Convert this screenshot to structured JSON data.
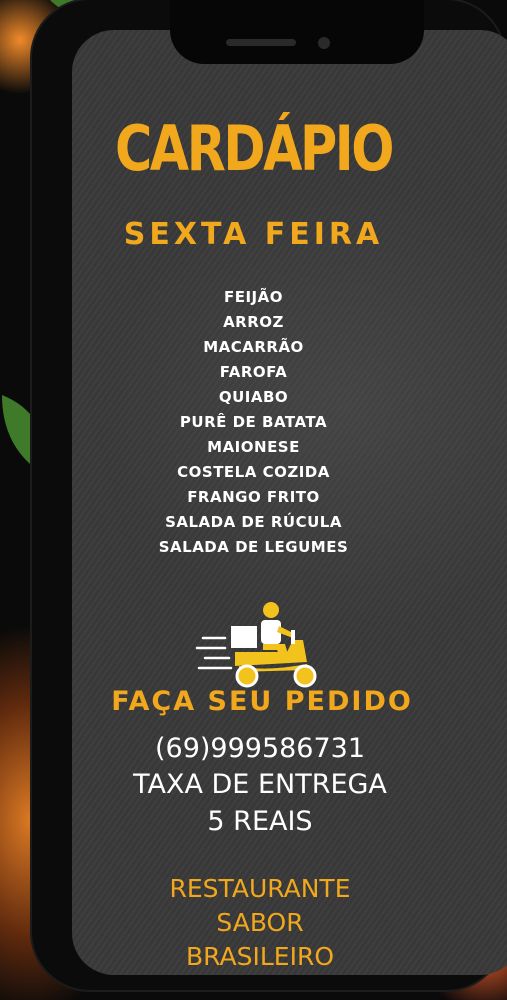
{
  "menu": {
    "title": "CARDÁPIO",
    "day": "SEXTA FEIRA",
    "items": [
      "FEIJÃO",
      "ARROZ",
      "MACARRÃO",
      "FAROFA",
      "QUIABO",
      "PURÊ DE BATATA",
      "MAIONESE",
      "COSTELA COZIDA",
      "FRANGO FRITO",
      "SALADA DE RÚCULA",
      "SALADA DE LEGUMES"
    ]
  },
  "order": {
    "call_to_action": "FAÇA SEU PEDIDO",
    "phone": "(69)999586731",
    "delivery_fee_label": "TAXA DE ENTREGA",
    "delivery_fee_value": "5 REAIS"
  },
  "restaurant": {
    "name_lines": [
      "RESTAURANTE",
      "SABOR",
      "BRASILEIRO"
    ]
  },
  "icons": {
    "delivery": "delivery-scooter-icon"
  },
  "colors": {
    "accent": "#f2a81d",
    "text": "#ffffff",
    "board": "#3a3a3a"
  }
}
